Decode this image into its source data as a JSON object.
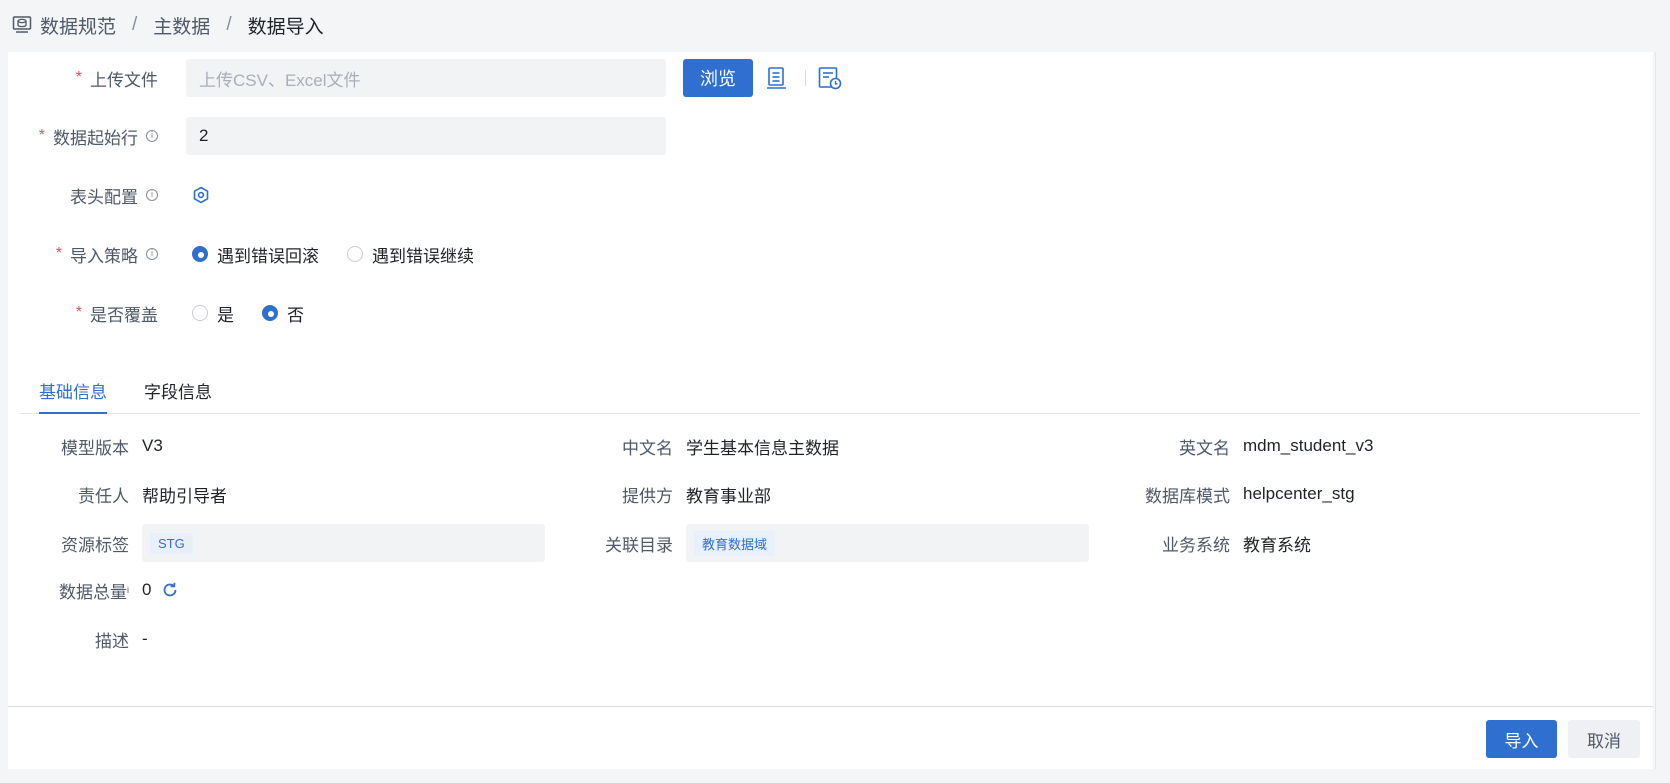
{
  "breadcrumb": {
    "items": [
      "数据规范",
      "主数据",
      "数据导入"
    ],
    "separator": "/"
  },
  "form": {
    "upload": {
      "label": "上传文件",
      "placeholder": "上传CSV、Excel文件",
      "browse_label": "浏览",
      "icons": [
        "template-icon",
        "history-icon"
      ]
    },
    "start_row": {
      "label": "数据起始行",
      "value": "2"
    },
    "header_config": {
      "label": "表头配置",
      "icon": "settings-hex-icon"
    },
    "strategy": {
      "label": "导入策略",
      "options": [
        {
          "label": "遇到错误回滚",
          "checked": true
        },
        {
          "label": "遇到错误继续",
          "checked": false
        }
      ]
    },
    "overwrite": {
      "label": "是否覆盖",
      "options": [
        {
          "label": "是",
          "checked": false
        },
        {
          "label": "否",
          "checked": true
        }
      ]
    }
  },
  "tabs": [
    {
      "label": "基础信息",
      "active": true
    },
    {
      "label": "字段信息",
      "active": false
    }
  ],
  "info": {
    "model_version": {
      "label": "模型版本",
      "value": "V3"
    },
    "chinese_name": {
      "label": "中文名",
      "value": "学生基本信息主数据"
    },
    "english_name": {
      "label": "英文名",
      "value": "mdm_student_v3"
    },
    "owner": {
      "label": "责任人",
      "value": "帮助引导者"
    },
    "provider": {
      "label": "提供方",
      "value": "教育事业部"
    },
    "db_schema": {
      "label": "数据库模式",
      "value": "helpcenter_stg"
    },
    "resource_tag": {
      "label": "资源标签",
      "tag": "STG"
    },
    "catalog": {
      "label": "关联目录",
      "tag": "教育数据域"
    },
    "business_system": {
      "label": "业务系统",
      "value": "教育系统"
    },
    "total": {
      "label": "数据总量",
      "value": "0"
    },
    "description": {
      "label": "描述",
      "value": "-"
    }
  },
  "footer": {
    "import_label": "导入",
    "cancel_label": "取消"
  },
  "colors": {
    "primary": "#2f6fd0",
    "required": "#e34d59",
    "input_bg": "#f2f3f5"
  }
}
